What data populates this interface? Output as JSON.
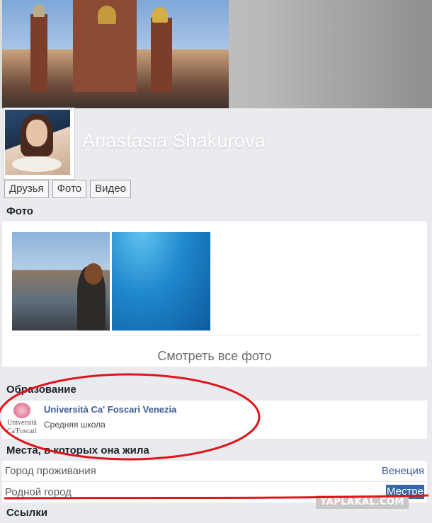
{
  "profile": {
    "name": "Anastasia Shakurova"
  },
  "tabs": [
    {
      "label": "Друзья"
    },
    {
      "label": "Фото"
    },
    {
      "label": "Видео"
    }
  ],
  "photos_section": {
    "title": "Фото",
    "see_all": "Смотреть все фото"
  },
  "education_section": {
    "title": "Образование",
    "logo_text_line1": "Università",
    "logo_text_line2": "Ca'Foscari",
    "school_name": "Università Ca' Foscari Venezia",
    "school_type": "Средняя школа"
  },
  "places_section": {
    "title": "Места, в которых она жила",
    "rows": [
      {
        "label": "Город проживания",
        "value": "Венеция"
      },
      {
        "label": "Родной город",
        "value": "Местре"
      }
    ]
  },
  "links_section": {
    "title": "Ссылки"
  },
  "watermark": "YAPLAKAL.COM",
  "colors": {
    "link": "#3b5998",
    "annotation_red": "#e0141b",
    "selection": "#3366aa"
  }
}
